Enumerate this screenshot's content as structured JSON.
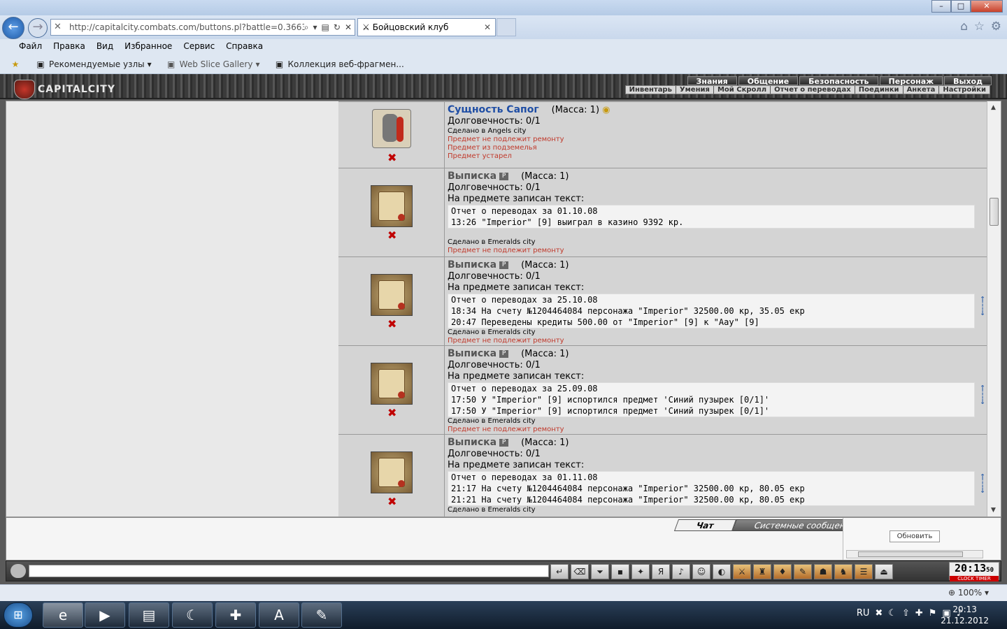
{
  "browser": {
    "url": "http://capitalcity.combats.com/buttons.pl?battle=0.36637833",
    "tab_title": "Бойцовский клуб",
    "menu": [
      "Файл",
      "Правка",
      "Вид",
      "Избранное",
      "Сервис",
      "Справка"
    ],
    "favorites": [
      "Рекомендуемые узлы",
      "Web Slice Gallery",
      "Коллекция веб-фрагмен..."
    ],
    "zoom": "100%"
  },
  "game": {
    "logo": "CAPITALCITY",
    "top_nav": [
      "Знания",
      "Общение",
      "Безопасность",
      "Персонаж",
      "Выход"
    ],
    "sub_nav": [
      "Инвентарь",
      "Умения",
      "Мой Скролл",
      "Отчет о переводах",
      "Поединки",
      "Анкета",
      "Настройки"
    ]
  },
  "items": [
    {
      "name": "Сущность Сапог",
      "mass": "(Масса: 1)",
      "durability": "Долговечность: 0/1",
      "made": "Сделано в Angels city",
      "notes": [
        "Предмет не подлежит ремонту",
        "Предмет из подземелья",
        "Предмет устарел"
      ]
    },
    {
      "name": "Выписка",
      "badge": "P",
      "mass": "(Масса: 1)",
      "durability": "Долговечность: 0/1",
      "text_label": "На предмете записан текст:",
      "text_lines": [
        "Отчет о переводах за 01.10.08",
        "13:26 \"Imperior\" [9] выиграл в казино 9392 кр."
      ],
      "made": "Сделано в Emeralds city",
      "notes": [
        "Предмет не подлежит ремонту"
      ]
    },
    {
      "name": "Выписка",
      "badge": "P",
      "mass": "(Масса: 1)",
      "durability": "Долговечность: 0/1",
      "text_label": "На предмете записан текст:",
      "text_lines": [
        "Отчет о переводах за 25.10.08",
        "18:34 На счету №1204464084 персонажа \"Imperior\" 32500.00 кр, 35.05 екр",
        "20:47 Переведены кредиты 500.00 от \"Imperior\" [9] к \"Aay\" [9]"
      ],
      "made": "Сделано в Emeralds city",
      "notes": [
        "Предмет не подлежит ремонту"
      ]
    },
    {
      "name": "Выписка",
      "badge": "P",
      "mass": "(Масса: 1)",
      "durability": "Долговечность: 0/1",
      "text_label": "На предмете записан текст:",
      "text_lines": [
        "Отчет о переводах за 25.09.08",
        "17:50 У \"Imperior\" [9] испортился предмет 'Синий пузырек [0/1]'",
        "17:50 У \"Imperior\" [9] испортился предмет 'Синий пузырек [0/1]'"
      ],
      "made": "Сделано в Emeralds city",
      "notes": [
        "Предмет не подлежит ремонту"
      ]
    },
    {
      "name": "Выписка",
      "badge": "P",
      "mass": "(Масса: 1)",
      "durability": "Долговечность: 0/1",
      "text_label": "На предмете записан текст:",
      "text_lines": [
        "Отчет о переводах за 01.11.08",
        "21:17 На счету №1204464084 персонажа \"Imperior\" 32500.00 кр, 80.05 екр",
        "21:21 На счету №1204464084 персонажа \"Imperior\" 32500.00 кр, 80.05 екр"
      ],
      "made": "Сделано в Emeralds city",
      "notes": []
    }
  ],
  "chat": {
    "tab_chat": "Чат",
    "tab_system": "Системные сообщения",
    "refresh": "Обновить"
  },
  "clock": {
    "time": "20:13",
    "sec": "50",
    "label_clock": "CLOCK",
    "label_timer": "TIMER"
  },
  "taskbar": {
    "lang": "RU",
    "time": "20:13",
    "date": "21.12.2012"
  }
}
